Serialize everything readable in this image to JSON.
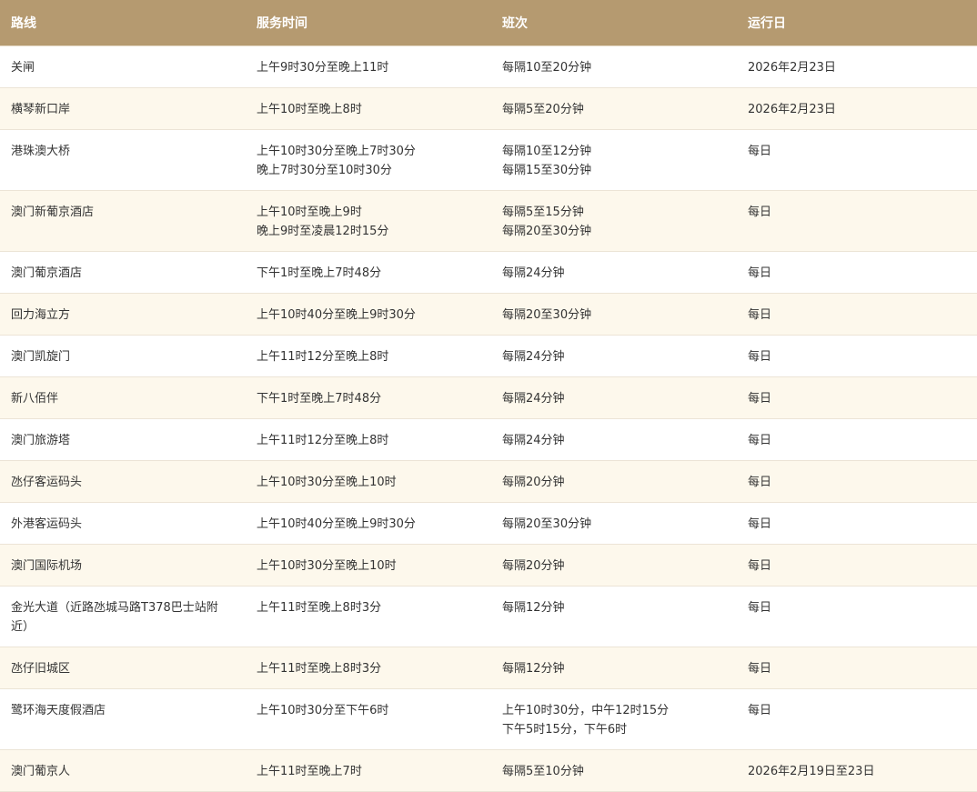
{
  "table": {
    "headers": [
      "路线",
      "服务时间",
      "班次",
      "运行日"
    ],
    "rows": [
      {
        "route": "关闸",
        "hours": [
          "上午9时30分至晚上11时"
        ],
        "frequency": [
          "每隔10至20分钟"
        ],
        "days": "2026年2月23日"
      },
      {
        "route": "横琴新口岸",
        "hours": [
          "上午10时至晚上8时"
        ],
        "frequency": [
          "每隔5至20分钟"
        ],
        "days": "2026年2月23日"
      },
      {
        "route": "港珠澳大桥",
        "hours": [
          "上午10时30分至晚上7时30分",
          "晚上7时30分至10时30分"
        ],
        "frequency": [
          "每隔10至12分钟",
          "每隔15至30分钟"
        ],
        "days": "每日"
      },
      {
        "route": "澳门新葡京酒店",
        "hours": [
          "上午10时至晚上9时",
          "晚上9时至凌晨12时15分"
        ],
        "frequency": [
          "每隔5至15分钟",
          "每隔20至30分钟"
        ],
        "days": "每日"
      },
      {
        "route": "澳门葡京酒店",
        "hours": [
          "下午1时至晚上7时48分"
        ],
        "frequency": [
          "每隔24分钟"
        ],
        "days": "每日"
      },
      {
        "route": "回力海立方",
        "hours": [
          "上午10时40分至晚上9时30分"
        ],
        "frequency": [
          "每隔20至30分钟"
        ],
        "days": "每日"
      },
      {
        "route": "澳门凯旋门",
        "hours": [
          "上午11时12分至晚上8时"
        ],
        "frequency": [
          "每隔24分钟"
        ],
        "days": "每日"
      },
      {
        "route": "新八佰伴",
        "hours": [
          "下午1时至晚上7时48分"
        ],
        "frequency": [
          "每隔24分钟"
        ],
        "days": "每日"
      },
      {
        "route": "澳门旅游塔",
        "hours": [
          "上午11时12分至晚上8时"
        ],
        "frequency": [
          "每隔24分钟"
        ],
        "days": "每日"
      },
      {
        "route": "氹仔客运码头",
        "hours": [
          "上午10时30分至晚上10时"
        ],
        "frequency": [
          "每隔20分钟"
        ],
        "days": "每日"
      },
      {
        "route": "外港客运码头",
        "hours": [
          "上午10时40分至晚上9时30分"
        ],
        "frequency": [
          "每隔20至30分钟"
        ],
        "days": "每日"
      },
      {
        "route": "澳门国际机场",
        "hours": [
          "上午10时30分至晚上10时"
        ],
        "frequency": [
          "每隔20分钟"
        ],
        "days": "每日"
      },
      {
        "route": "金光大道（近路氹城马路T378巴士站附近）",
        "hours": [
          "上午11时至晚上8时3分"
        ],
        "frequency": [
          "每隔12分钟"
        ],
        "days": "每日"
      },
      {
        "route": "氹仔旧城区",
        "hours": [
          "上午11时至晚上8时3分"
        ],
        "frequency": [
          "每隔12分钟"
        ],
        "days": "每日"
      },
      {
        "route": "鹭环海天度假酒店",
        "hours": [
          "上午10时30分至下午6时"
        ],
        "frequency": [
          "上午10时30分，中午12时15分",
          "下午5时15分，下午6时"
        ],
        "days": "每日"
      },
      {
        "route": "澳门葡京人",
        "hours": [
          "上午11时至晚上7时"
        ],
        "frequency": [
          "每隔5至10分钟"
        ],
        "days": "2026年2月19日至23日"
      }
    ]
  }
}
